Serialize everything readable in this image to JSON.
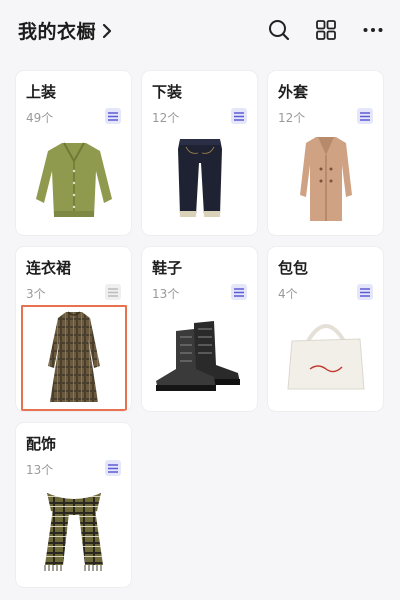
{
  "header": {
    "title": "我的衣橱",
    "icons": [
      "chevron-right-icon",
      "search-icon",
      "grid-icon",
      "more-icon"
    ]
  },
  "categories": [
    {
      "name": "上装",
      "count": "49个",
      "icon": "list-icon",
      "image": "green-cardigan"
    },
    {
      "name": "下装",
      "count": "12个",
      "icon": "list-icon",
      "image": "dark-jeans"
    },
    {
      "name": "外套",
      "count": "12个",
      "icon": "list-icon",
      "image": "camel-coat"
    },
    {
      "name": "连衣裙",
      "count": "3个",
      "icon": "list-icon",
      "image": "plaid-dress",
      "selected": true
    },
    {
      "name": "鞋子",
      "count": "13个",
      "icon": "list-icon",
      "image": "black-boots"
    },
    {
      "name": "包包",
      "count": "4个",
      "icon": "list-icon",
      "image": "white-tote"
    },
    {
      "name": "配饰",
      "count": "13个",
      "icon": "list-icon",
      "image": "plaid-scarf"
    }
  ],
  "colors": {
    "badge_bg": "#e6e6fb",
    "badge_icon": "#5b5bd6",
    "selected_border": "#e8714e"
  }
}
